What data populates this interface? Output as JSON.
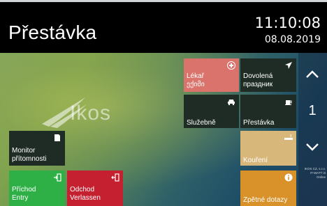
{
  "header": {
    "title": "Přestávka",
    "time": "11:10:08",
    "date": "08.08.2019"
  },
  "background": {
    "logo_text": "Ikos"
  },
  "tiles": {
    "lekar": {
      "label1": "Lékař",
      "label2": "ექიმი",
      "color": "#d9736b"
    },
    "dovolena": {
      "label1": "Dovolená",
      "label2": "праздник",
      "color": "#1f2c25"
    },
    "sluzebne": {
      "label1": "Služebně",
      "color": "#1f2c25"
    },
    "prestavka": {
      "label1": "Přestávka",
      "color": "#1f2c25"
    },
    "koureni": {
      "label1": "Kouření",
      "color": "#d8b77a"
    },
    "monitor": {
      "label1": "Monitor",
      "label2": "přítomnosti",
      "color": "#1f2c25"
    },
    "prichod": {
      "label1": "Příchod",
      "label2": "Entry",
      "color": "#2fb046"
    },
    "odchod": {
      "label1": "Odchod",
      "label2": "Verlassen",
      "color": "#c5202f"
    },
    "zpetne": {
      "label1": "Zpětné dotazy",
      "color": "#d9922a"
    }
  },
  "nav": {
    "page": "1"
  },
  "footer": {
    "company_line1": "IKOS CZ, s.r.o.",
    "company_line2": "IT-WATT i3",
    "status": "Online"
  }
}
